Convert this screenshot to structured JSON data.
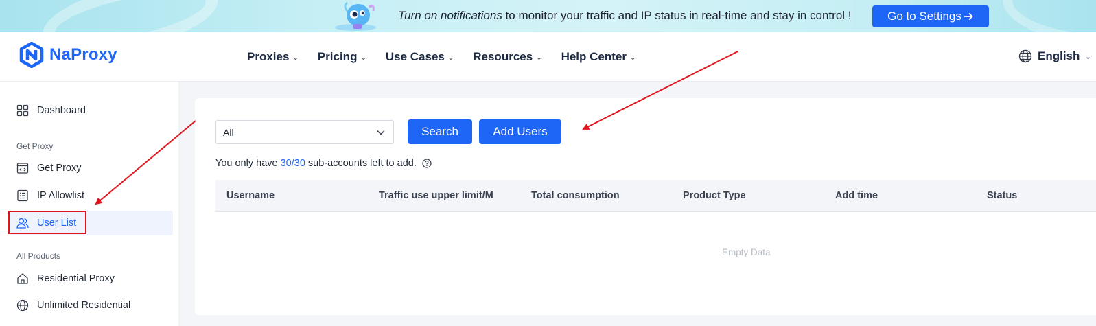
{
  "banner": {
    "text_emphasis": "Turn on notifications",
    "text_rest": " to monitor your traffic and IP status in real-time and stay in control !",
    "button_label": "Go to Settings"
  },
  "header": {
    "brand": "NaProxy",
    "nav": [
      "Proxies",
      "Pricing",
      "Use Cases",
      "Resources",
      "Help Center"
    ],
    "language": "English"
  },
  "sidebar": {
    "dashboard": "Dashboard",
    "group_get_proxy": "Get Proxy",
    "get_proxy": "Get Proxy",
    "ip_allowlist": "IP Allowlist",
    "user_list": "User List",
    "group_all_products": "All Products",
    "residential_proxy": "Residential Proxy",
    "unlimited_residential": "Unlimited Residential"
  },
  "filter": {
    "selected": "All"
  },
  "buttons": {
    "search": "Search",
    "add_users": "Add Users"
  },
  "quota": {
    "prefix": "You only have",
    "used": "30",
    "total": "30",
    "suffix": "sub-accounts left to add."
  },
  "table": {
    "columns": [
      "Username",
      "Traffic use upper limit/M",
      "Total consumption",
      "Product Type",
      "Add time",
      "Status"
    ],
    "empty_text": "Empty Data"
  },
  "colors": {
    "accent": "#1e66f5",
    "annotation": "#e0141b"
  }
}
